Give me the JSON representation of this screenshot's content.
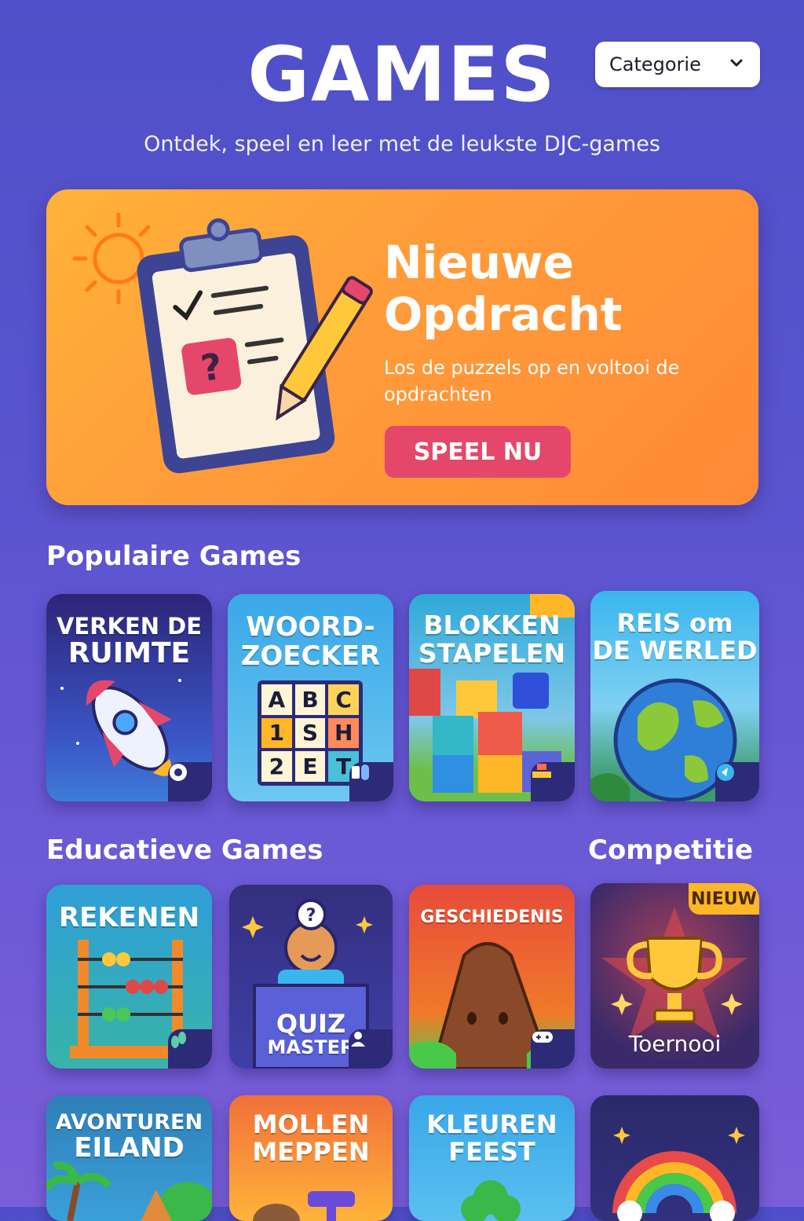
{
  "header": {
    "title": "GAMES",
    "subtitle": "Ontdek, speel en leer met de leukste DJC-games",
    "category_select": {
      "selected": "Categorie",
      "icon": "chevron-down-icon"
    }
  },
  "hero": {
    "title": "Nieuwe Opdracht",
    "description": "Los de puzzels op en voltooi de opdrachten",
    "button": "SPEEL NU",
    "illustration": "clipboard-pencil-sun"
  },
  "sections": {
    "popular": {
      "title": "Populaire Games"
    },
    "educational": {
      "title": "Educatieve Games"
    },
    "competition": {
      "title": "Competitie"
    }
  },
  "popular_games": [
    {
      "line1": "VERKEN DE",
      "line2": "RUIMTE",
      "icon": "rocket-icon"
    },
    {
      "line1": "WOORD-",
      "line2": "ZOECKER",
      "grid": [
        "A",
        "B",
        "C",
        "1",
        "S",
        "H",
        "2",
        "E",
        "T"
      ],
      "icon": "puzzle-icon"
    },
    {
      "line1": "BLOKKEN",
      "line2": "STAPELEN",
      "icon": "blocks-icon"
    },
    {
      "line1": "REIS om",
      "line2": "DE WERLED",
      "icon": "globe-icon"
    }
  ],
  "educational_games": [
    {
      "title": "REKENEN",
      "icon": "abacus-icon"
    },
    {
      "title": "GESCHIEDENIS",
      "icon": "volcano-icon"
    },
    {
      "title_line1": "QUIZ",
      "title_line2": "MASTER",
      "icon": "user-icon"
    }
  ],
  "competition_game": {
    "tag": "NIEUW",
    "title": "Toernooi",
    "icon": "trophy-icon"
  },
  "more_games": [
    {
      "line1": "AVONTUREN",
      "line2": "EILAND"
    },
    {
      "line1": "MOLLEN",
      "line2": "MEPPEN"
    },
    {
      "line1": "KLEUREN",
      "line2": "FEEST"
    },
    {
      "line1": "",
      "line2": "",
      "icon": "rainbow-icon"
    }
  ],
  "colors": {
    "hero": "#ff9b3a",
    "play_button": "#e5476b",
    "badge": "#2d2a78",
    "new_tag": "#ffb627"
  }
}
